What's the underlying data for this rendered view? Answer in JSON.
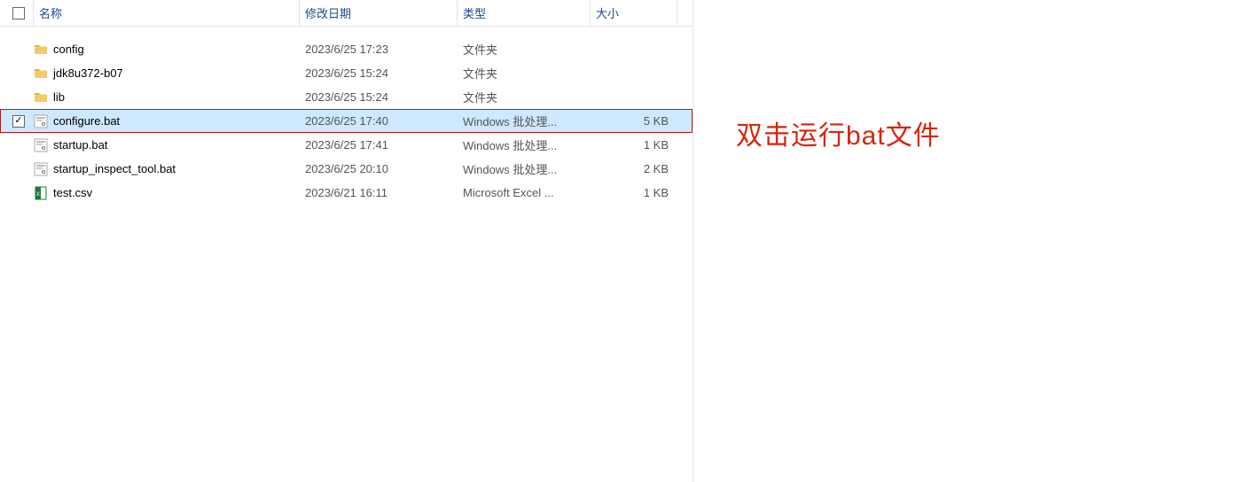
{
  "columns": {
    "name": "名称",
    "date": "修改日期",
    "type": "类型",
    "size": "大小"
  },
  "rows": [
    {
      "icon": "folder",
      "name": "config",
      "date": "2023/6/25 17:23",
      "type": "文件夹",
      "size": "",
      "selected": false,
      "checked": false
    },
    {
      "icon": "folder",
      "name": "jdk8u372-b07",
      "date": "2023/6/25 15:24",
      "type": "文件夹",
      "size": "",
      "selected": false,
      "checked": false
    },
    {
      "icon": "folder",
      "name": "lib",
      "date": "2023/6/25 15:24",
      "type": "文件夹",
      "size": "",
      "selected": false,
      "checked": false
    },
    {
      "icon": "bat",
      "name": "configure.bat",
      "date": "2023/6/25 17:40",
      "type": "Windows 批处理...",
      "size": "5 KB",
      "selected": true,
      "checked": true
    },
    {
      "icon": "bat",
      "name": "startup.bat",
      "date": "2023/6/25 17:41",
      "type": "Windows 批处理...",
      "size": "1 KB",
      "selected": false,
      "checked": false
    },
    {
      "icon": "bat",
      "name": "startup_inspect_tool.bat",
      "date": "2023/6/25 20:10",
      "type": "Windows 批处理...",
      "size": "2 KB",
      "selected": false,
      "checked": false
    },
    {
      "icon": "csv",
      "name": "test.csv",
      "date": "2023/6/21 16:11",
      "type": "Microsoft Excel ...",
      "size": "1 KB",
      "selected": false,
      "checked": false
    }
  ],
  "annotation": "双击运行bat文件"
}
